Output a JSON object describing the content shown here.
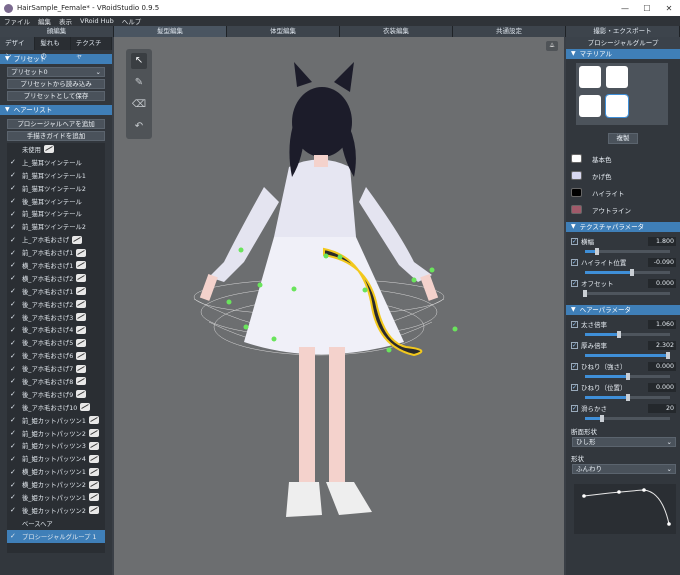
{
  "window": {
    "title": "HairSample_Female* - VRoidStudio 0.9.5",
    "controls": [
      "—",
      "☐",
      "✕"
    ]
  },
  "menu": [
    "ファイル",
    "編集",
    "表示",
    "VRoid Hub",
    "ヘルプ"
  ],
  "main_tabs": [
    "顔編集",
    "髪型編集",
    "体型編集",
    "衣装編集",
    "共通設定",
    "撮影・エクスポート"
  ],
  "left": {
    "subtabs": [
      "デザイン",
      "髪れもの",
      "テクスチャ"
    ],
    "preset_header": "プリセット",
    "preset_select": "プリセット0",
    "preset_load": "プリセットから読み込み",
    "preset_save": "プリセットとして保存",
    "hairlist_header": "ヘアーリスト",
    "add_procedural": "プロシージャルヘアを追加",
    "add_guide": "手描きガイドを追加",
    "items": [
      {
        "label": "未使用",
        "check": "",
        "hidden": true
      },
      {
        "label": "上_猫耳ツインテール",
        "check": "✓",
        "hidden": false
      },
      {
        "label": "前_猫耳ツインテール1",
        "check": "✓",
        "hidden": false
      },
      {
        "label": "前_猫耳ツインテール2",
        "check": "✓",
        "hidden": false
      },
      {
        "label": "後_猫耳ツインテール",
        "check": "✓",
        "hidden": false
      },
      {
        "label": "前_猫耳ツインテール",
        "check": "✓",
        "hidden": false
      },
      {
        "label": "前_猫耳ツインテール2",
        "check": "✓",
        "hidden": false
      },
      {
        "label": "上_アホ毛おさげ",
        "check": "✓",
        "hidden": true
      },
      {
        "label": "前_アホ毛おさげ1",
        "check": "✓",
        "hidden": true
      },
      {
        "label": "横_アホ毛おさげ1",
        "check": "✓",
        "hidden": true
      },
      {
        "label": "横_アホ毛おさげ2",
        "check": "✓",
        "hidden": true
      },
      {
        "label": "後_アホ毛おさげ1",
        "check": "✓",
        "hidden": true
      },
      {
        "label": "後_アホ毛おさげ2",
        "check": "✓",
        "hidden": true
      },
      {
        "label": "後_アホ毛おさげ3",
        "check": "✓",
        "hidden": true
      },
      {
        "label": "後_アホ毛おさげ4",
        "check": "✓",
        "hidden": true
      },
      {
        "label": "後_アホ毛おさげ5",
        "check": "✓",
        "hidden": true
      },
      {
        "label": "後_アホ毛おさげ6",
        "check": "✓",
        "hidden": true
      },
      {
        "label": "後_アホ毛おさげ7",
        "check": "✓",
        "hidden": true
      },
      {
        "label": "後_アホ毛おさげ8",
        "check": "✓",
        "hidden": true
      },
      {
        "label": "後_アホ毛おさげ9",
        "check": "✓",
        "hidden": true
      },
      {
        "label": "後_アホ毛おさげ10",
        "check": "✓",
        "hidden": true
      },
      {
        "label": "前_姫カットパッツン1",
        "check": "✓",
        "hidden": true
      },
      {
        "label": "前_姫カットパッツン2",
        "check": "✓",
        "hidden": true
      },
      {
        "label": "前_姫カットパッツン3",
        "check": "✓",
        "hidden": true
      },
      {
        "label": "前_姫カットパッツン4",
        "check": "✓",
        "hidden": true
      },
      {
        "label": "横_姫カットパッツン1",
        "check": "✓",
        "hidden": true
      },
      {
        "label": "横_姫カットパッツン2",
        "check": "✓",
        "hidden": true
      },
      {
        "label": "後_姫カットパッツン1",
        "check": "✓",
        "hidden": true
      },
      {
        "label": "後_姫カットパッツン2",
        "check": "✓",
        "hidden": true
      },
      {
        "label": "ベースヘア",
        "check": "",
        "hidden": false
      },
      {
        "label": "プロシージャルグループ 1",
        "check": "✓",
        "hidden": false,
        "selected": true
      }
    ]
  },
  "right": {
    "title": "プロシージャルグループ",
    "material_header": "マテリアル",
    "duplicate": "複製",
    "colors": [
      {
        "label": "基本色",
        "color": "#ffffff"
      },
      {
        "label": "かげ色",
        "color": "#d8d8f0"
      },
      {
        "label": "ハイライト",
        "color": "#000000"
      },
      {
        "label": "アウトライン",
        "color": "#a05a6a"
      }
    ],
    "texture_header": "テクスチャパラメータ",
    "texture_params": [
      {
        "label": "横幅",
        "value": "1.800",
        "fraction": 0.14
      },
      {
        "label": "ハイライト位置",
        "value": "-0.090",
        "fraction": 0.55
      },
      {
        "label": "オフセット",
        "value": "0.000",
        "fraction": 0.0
      }
    ],
    "hair_header": "ヘアーパラメータ",
    "hair_params": [
      {
        "label": "太さ倍率",
        "value": "1.060",
        "fraction": 0.4
      },
      {
        "label": "厚み倍率",
        "value": "2.302",
        "fraction": 0.98
      },
      {
        "label": "ひねり（強さ）",
        "value": "0.000",
        "fraction": 0.5
      },
      {
        "label": "ひねり（位置）",
        "value": "0.000",
        "fraction": 0.5
      },
      {
        "label": "滑らかさ",
        "value": "20",
        "fraction": 0.2
      }
    ],
    "section_shape_label": "断面形状",
    "section_shape_value": "ひし形",
    "shape_label": "形状",
    "shape_value": "ふんわり"
  }
}
